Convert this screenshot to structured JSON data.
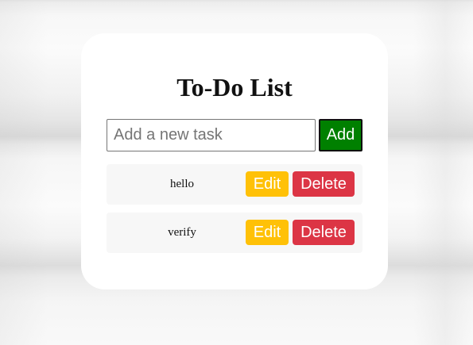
{
  "app": {
    "title": "To-Do List"
  },
  "add_form": {
    "input_placeholder": "Add a new task",
    "input_value": "",
    "add_label": "Add"
  },
  "tasks": [
    {
      "text": "hello",
      "edit_label": "Edit",
      "delete_label": "Delete"
    },
    {
      "text": "verify",
      "edit_label": "Edit",
      "delete_label": "Delete"
    }
  ],
  "colors": {
    "add_button": "#008000",
    "edit_button": "#ffc107",
    "delete_button": "#dc3545",
    "card_background": "#ffffff",
    "task_background": "#f7f7f7"
  }
}
